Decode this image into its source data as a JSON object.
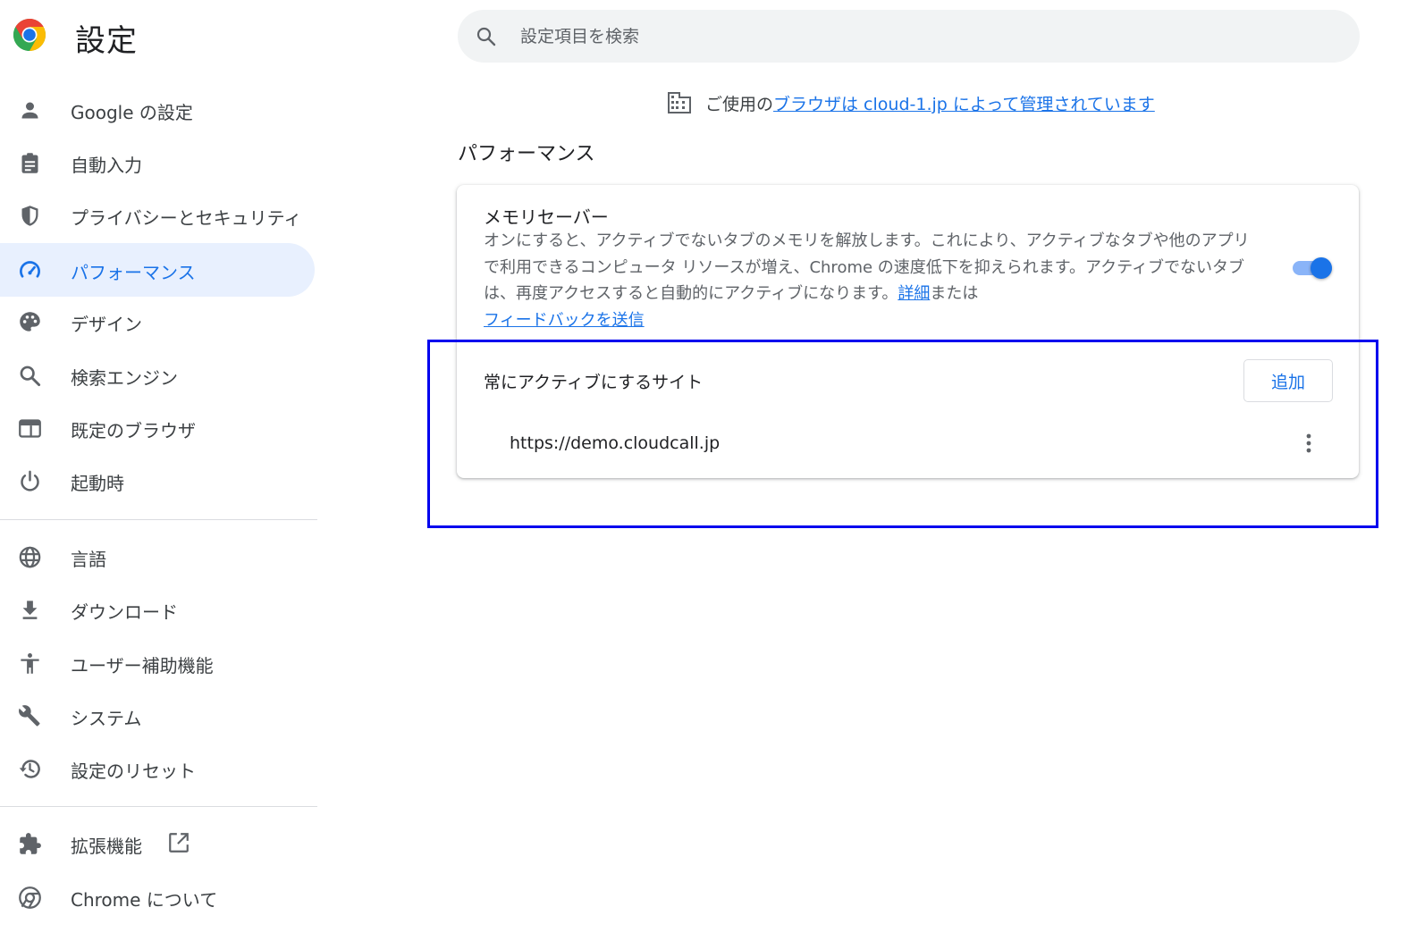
{
  "header": {
    "title": "設定",
    "search_placeholder": "設定項目を検索"
  },
  "sidebar": {
    "items": [
      {
        "label": "Google の設定",
        "icon": "person-icon"
      },
      {
        "label": "自動入力",
        "icon": "clipboard-icon"
      },
      {
        "label": "プライバシーとセキュリティ",
        "icon": "shield-icon"
      },
      {
        "label": "パフォーマンス",
        "icon": "speedometer-icon",
        "active": true
      },
      {
        "label": "デザイン",
        "icon": "palette-icon"
      },
      {
        "label": "検索エンジン",
        "icon": "search-icon"
      },
      {
        "label": "既定のブラウザ",
        "icon": "browser-window-icon"
      },
      {
        "label": "起動時",
        "icon": "power-icon"
      },
      {
        "label": "言語",
        "icon": "globe-icon"
      },
      {
        "label": "ダウンロード",
        "icon": "download-icon"
      },
      {
        "label": "ユーザー補助機能",
        "icon": "accessibility-icon"
      },
      {
        "label": "システム",
        "icon": "wrench-icon"
      },
      {
        "label": "設定のリセット",
        "icon": "history-icon"
      },
      {
        "label": "拡張機能",
        "icon": "puzzle-icon"
      },
      {
        "label": "Chrome について",
        "icon": "chrome-icon"
      }
    ]
  },
  "managed": {
    "prefix": "ご使用の",
    "link": "ブラウザは cloud-1.jp によって管理されています"
  },
  "section": {
    "title": "パフォーマンス"
  },
  "memory_saver": {
    "title": "メモリセーバー",
    "description": "オンにすると、アクティブでないタブのメモリを解放します。これにより、アクティブなタブや他のアプリで利用できるコンピュータ リソースが増え、Chrome の速度低下を抑えられます。アクティブでないタブは、再度アクセスすると自動的にアクティブになります。",
    "details_link": "詳細",
    "or_text": "または",
    "feedback_link": "フィードバックを送信",
    "enabled": true
  },
  "always_active": {
    "title": "常にアクティブにするサイト",
    "add_label": "追加",
    "sites": [
      "https://demo.cloudcall.jp"
    ]
  },
  "colors": {
    "accent": "#1a73e8",
    "active_bg": "#e8f0fe",
    "highlight_border": "#0000ee"
  }
}
